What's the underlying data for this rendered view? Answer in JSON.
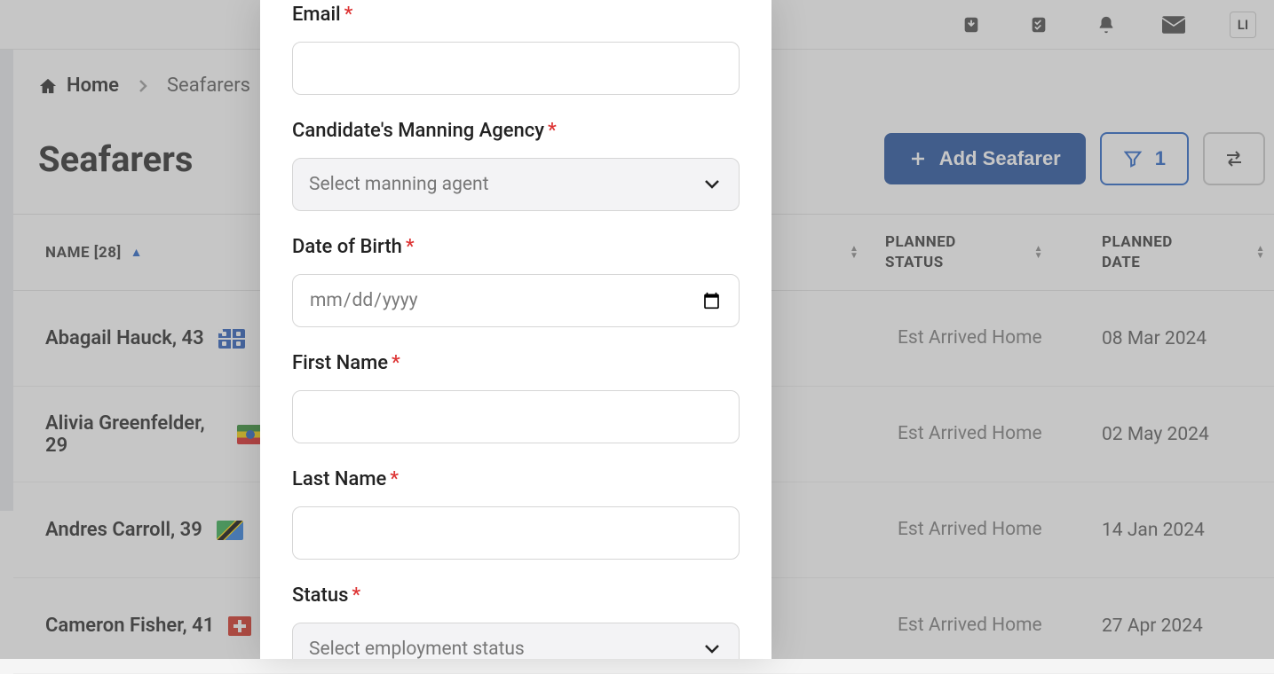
{
  "breadcrumb": {
    "home": "Home",
    "seafarers": "Seafarers"
  },
  "page": {
    "title": "Seafarers",
    "add_button": "Add Seafarer",
    "filter_count": "1"
  },
  "table": {
    "columns": {
      "name": "NAME [28]",
      "planned_status": "PLANNED STATUS",
      "planned_date": "PLANNED DATE"
    },
    "rows": [
      {
        "name": "Abagail Hauck, 43",
        "flag": "mq",
        "status": "Est Arrived Home",
        "date": "08 Mar 2024"
      },
      {
        "name": "Alivia Greenfelder, 29",
        "flag": "et",
        "status": "Est Arrived Home",
        "date": "02 May 2024"
      },
      {
        "name": "Andres Carroll, 39",
        "flag": "tz",
        "status": "Est Arrived Home",
        "date": "14 Jan 2024"
      },
      {
        "name": "Cameron Fisher, 41",
        "flag": "ch",
        "status": "Est Arrived Home",
        "date": "27 Apr 2024"
      }
    ]
  },
  "modal": {
    "email_label": "Email",
    "agency_label": "Candidate's Manning Agency",
    "agency_placeholder": "Select manning agent",
    "dob_label": "Date of Birth",
    "dob_placeholder": "mm/dd/yyyy",
    "first_name_label": "First Name",
    "last_name_label": "Last Name",
    "status_label": "Status",
    "status_placeholder": "Select employment status"
  },
  "topbar": {
    "badge": "LI"
  }
}
